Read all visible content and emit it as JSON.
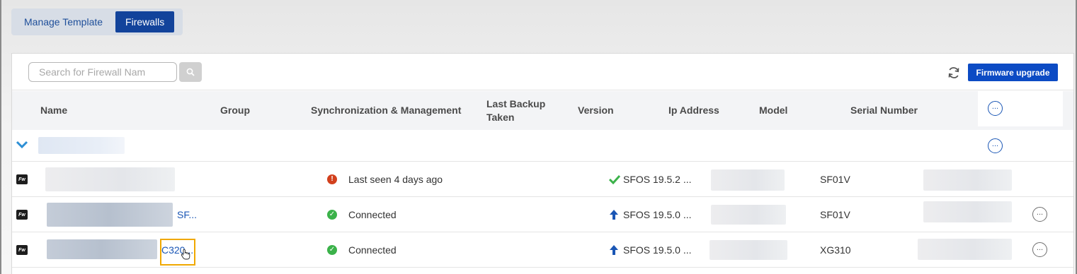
{
  "tabs": [
    {
      "label": "Manage Template",
      "active": false
    },
    {
      "label": "Firewalls",
      "active": true
    }
  ],
  "search": {
    "placeholder": "Search for Firewall Nam",
    "value": ""
  },
  "toolbar": {
    "firmware_upgrade_label": "Firmware upgrade",
    "refresh_icon": "refresh-icon",
    "search_icon": "search-icon"
  },
  "columns": {
    "name": "Name",
    "group": "Group",
    "sync": "Synchronization & Management",
    "last_backup": "Last Backup Taken",
    "version": "Version",
    "ip": "Ip Address",
    "model": "Model",
    "serial": "Serial Number"
  },
  "rows": [
    {
      "icon_label": "Fw",
      "group": "",
      "status": "Last seen 4 days ago",
      "status_type": "warning",
      "version_icon": "check-icon",
      "version": "SFOS 19.5.2 ...",
      "model": "SF01V"
    },
    {
      "icon_label": "Fw",
      "group": "SF...",
      "status": "Connected",
      "status_type": "ok",
      "version_icon": "arrow-up-icon",
      "version": "SFOS 19.5.0 ...",
      "model": "SF01V"
    },
    {
      "icon_label": "Fw",
      "group": "C320...",
      "status": "Connected",
      "status_type": "ok",
      "version_icon": "arrow-up-icon",
      "version": "SFOS 19.5.0 ...",
      "model": "XG310"
    }
  ],
  "colors": {
    "primary": "#0c4bc4",
    "tab_active": "#12439b",
    "link": "#1a56b5",
    "ok": "#3bb24a",
    "warning": "#d2401d",
    "highlight": "#f0a800"
  }
}
